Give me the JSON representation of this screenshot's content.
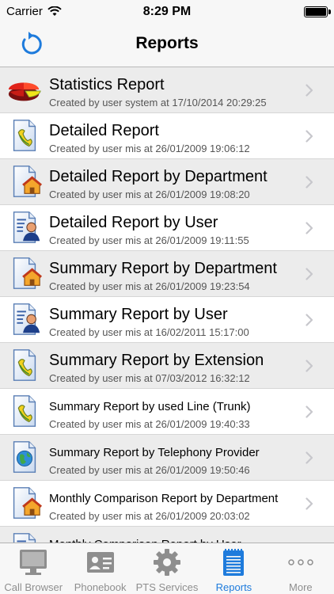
{
  "status_bar": {
    "carrier": "Carrier",
    "time": "8:29 PM"
  },
  "nav": {
    "title": "Reports"
  },
  "colors": {
    "accent": "#1e7bdc",
    "row_alt": "#ececec",
    "tab_inactive": "#8e8e8e"
  },
  "reports": [
    {
      "title": "Statistics Report",
      "subtitle": "Created by user system at 17/10/2014 20:29:25",
      "icon": "pie-chart-icon"
    },
    {
      "title": "Detailed Report",
      "subtitle": "Created by user mis at 26/01/2009 19:06:12",
      "icon": "phone-document-icon"
    },
    {
      "title": "Detailed Report by Department",
      "subtitle": "Created by user mis at 26/01/2009 19:08:20",
      "icon": "house-document-icon"
    },
    {
      "title": "Detailed Report by User",
      "subtitle": "Created by user mis at 26/01/2009 19:11:55",
      "icon": "user-document-icon"
    },
    {
      "title": "Summary Report by Department",
      "subtitle": "Created by user mis at 26/01/2009 19:23:54",
      "icon": "house-document-icon"
    },
    {
      "title": "Summary Report by User",
      "subtitle": "Created by user mis at 16/02/2011 15:17:00",
      "icon": "user-document-icon"
    },
    {
      "title": "Summary Report by Extension",
      "subtitle": "Created by user mis at 07/03/2012 16:32:12",
      "icon": "phone-document-icon"
    },
    {
      "title": "Summary Report by used Line (Trunk)",
      "subtitle": "Created by user mis at 26/01/2009 19:40:33",
      "icon": "phone-document-icon"
    },
    {
      "title": "Summary Report by Telephony Provider",
      "subtitle": "Created by user mis at 26/01/2009 19:50:46",
      "icon": "globe-document-icon"
    },
    {
      "title": "Monthly Comparison Report by Department",
      "subtitle": "Created by user mis at 26/01/2009 20:03:02",
      "icon": "house-document-icon"
    },
    {
      "title": "Monthly Comparison Report by User",
      "subtitle": "",
      "icon": "user-document-icon"
    }
  ],
  "tabs": [
    {
      "label": "Call Browser",
      "icon": "monitor-icon",
      "active": false
    },
    {
      "label": "Phonebook",
      "icon": "contact-card-icon",
      "active": false
    },
    {
      "label": "PTS Services",
      "icon": "gear-icon",
      "active": false
    },
    {
      "label": "Reports",
      "icon": "notepad-icon",
      "active": true
    },
    {
      "label": "More",
      "icon": "more-dots-icon",
      "active": false
    }
  ]
}
